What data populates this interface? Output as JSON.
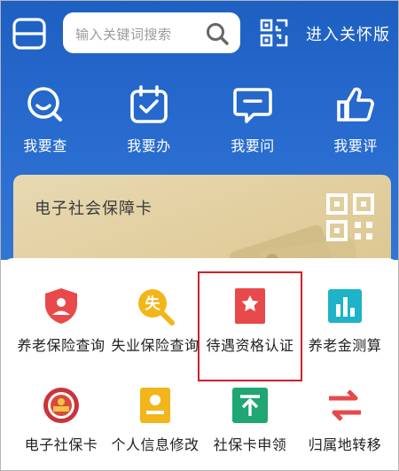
{
  "search": {
    "placeholder": "输入关键词搜索"
  },
  "header": {
    "care_mode_label": "进入关怀版"
  },
  "quick_actions": [
    {
      "label": "我要查",
      "icon": "search-face-icon"
    },
    {
      "label": "我要办",
      "icon": "calendar-check-icon"
    },
    {
      "label": "我要问",
      "icon": "chat-bubble-icon"
    },
    {
      "label": "我要评",
      "icon": "thumbs-up-icon"
    }
  ],
  "card": {
    "title": "电子社会保障卡",
    "icon": "qr-code-icon"
  },
  "services": [
    {
      "label": "养老保险查询",
      "icon": "shield-user-icon",
      "color": "#e8494a"
    },
    {
      "label": "失业保险查询",
      "icon": "unemployment-search-icon",
      "color": "#f2b61b",
      "badge": "失"
    },
    {
      "label": "待遇资格认证",
      "icon": "certificate-star-icon",
      "color": "#e8494a"
    },
    {
      "label": "养老金测算",
      "icon": "bar-chart-icon",
      "color": "#1eb3c8"
    },
    {
      "label": "电子社保卡",
      "icon": "social-security-emblem-icon",
      "color": "#c9343a"
    },
    {
      "label": "个人信息修改",
      "icon": "profile-card-icon",
      "color": "#f2b61b"
    },
    {
      "label": "社保卡申领",
      "icon": "card-apply-icon",
      "color": "#1fa672"
    },
    {
      "label": "归属地转移",
      "icon": "transfer-arrows-icon",
      "color": "#e8494a"
    }
  ],
  "highlight_color": "#d0202b"
}
